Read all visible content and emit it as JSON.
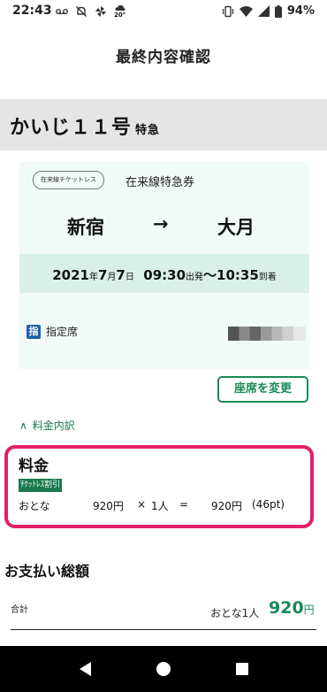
{
  "status_bar": {
    "time": "22:43",
    "weather_temp": "20°",
    "battery": "94%"
  },
  "header": {
    "title": "最終内容確認"
  },
  "train": {
    "name": "かいじ１１号",
    "type": "特急"
  },
  "ticket": {
    "badge": "在来線チケットレス",
    "ticket_type": "在来線特急券",
    "from": "新宿",
    "arrow": "→",
    "to": "大月",
    "date_year": "2021",
    "date_year_unit": "年",
    "date_month": "7",
    "date_month_unit": "月",
    "date_day": "7",
    "date_day_unit": "日",
    "depart_time": "09:30",
    "depart_label": "出発",
    "tilde": "〜",
    "arrive_time": "10:35",
    "arrive_label": "到着",
    "seat_icon": "指",
    "seat_label": "指定席"
  },
  "buttons": {
    "change_seat": "座席を変更"
  },
  "breakdown": {
    "toggle_icon": "∧",
    "toggle_label": "料金内訳"
  },
  "fare": {
    "title": "料金",
    "discount_label": "ﾁｹｯﾄﾚｽ割引",
    "passenger": "おとな",
    "unit_price": "920円",
    "times": "×",
    "count": "1人",
    "equals": "=",
    "subtotal": "920円",
    "points": "(46pt)"
  },
  "total": {
    "section_title": "お支払い総額",
    "label": "合計",
    "adult_count": "おとな1人",
    "amount": "920",
    "yen": "円"
  },
  "colors": {
    "accent_green": "#1a8a5a",
    "highlight_pink": "#e0206a",
    "card_bg": "#f2faf7",
    "date_bar_bg": "#d8f0e8"
  }
}
